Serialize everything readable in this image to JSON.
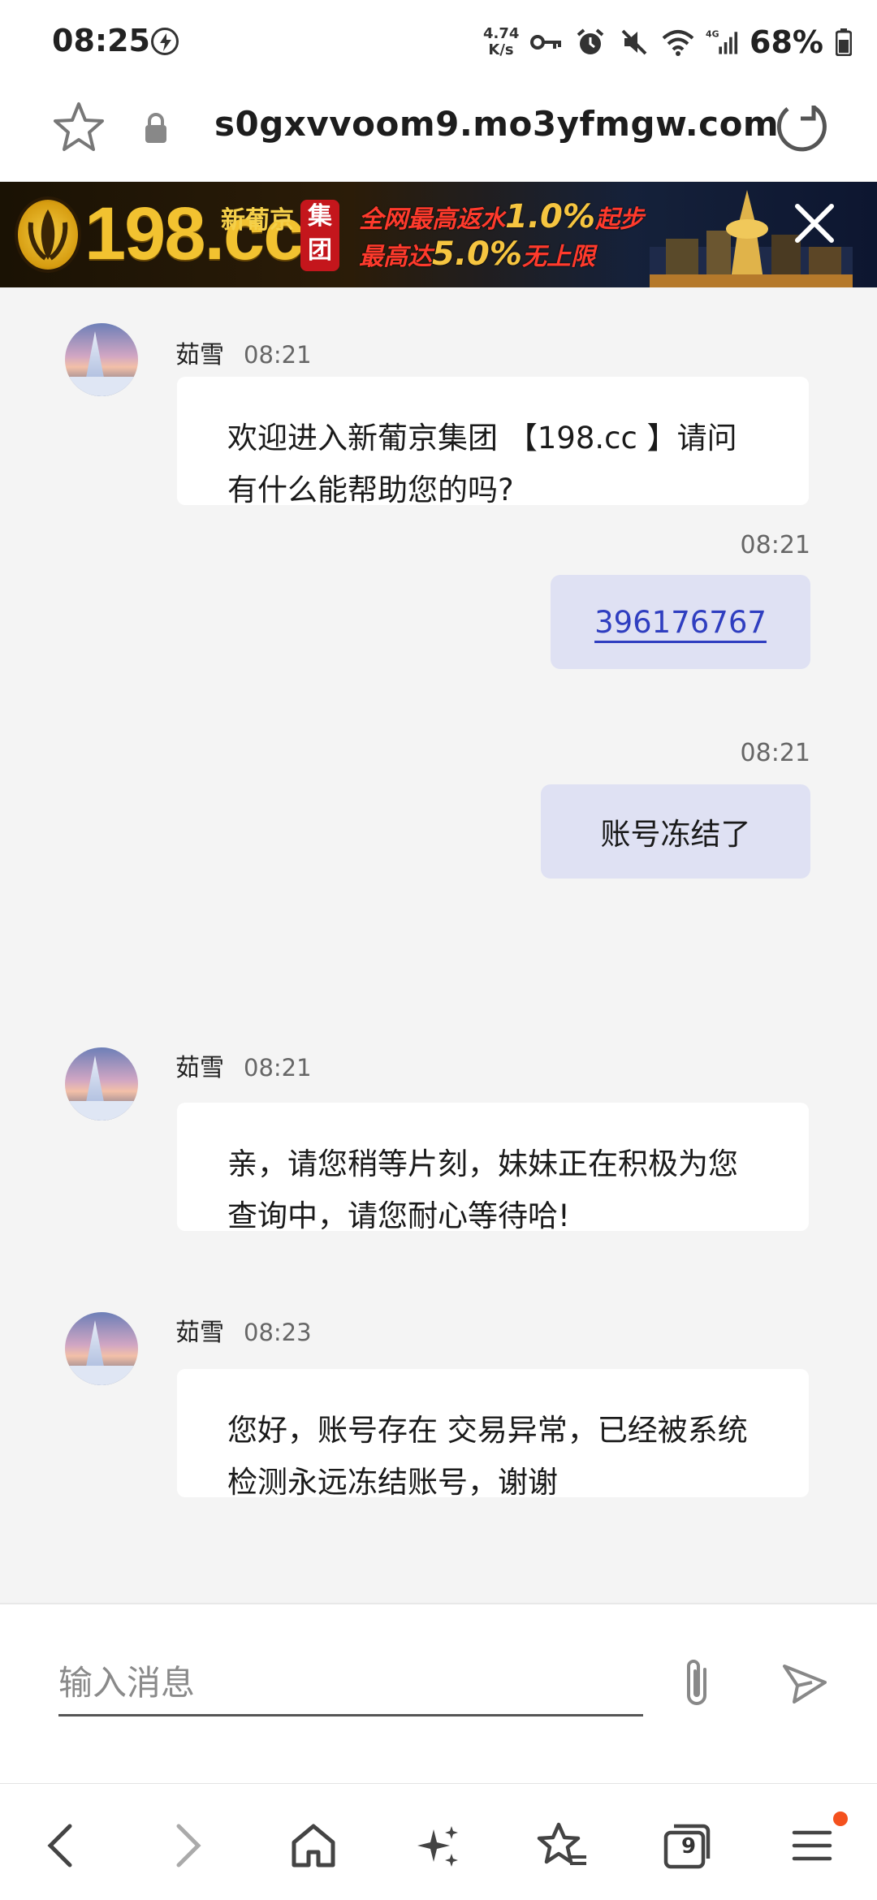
{
  "status_bar": {
    "time": "08:25",
    "net_speed_value": "4.74",
    "net_speed_unit": "K/s",
    "network": "4G",
    "battery": "68%"
  },
  "url_bar": {
    "url": "s0gxvvoom9.mo3yfmgw.com"
  },
  "ad": {
    "brand": "198.cc",
    "sub_brand": "新葡京",
    "seal": "集团",
    "line1_prefix": "全网最高返水",
    "line1_highlight": "1.0%",
    "line1_suffix": "起步",
    "line2_prefix": "最高达",
    "line2_highlight": "5.0%",
    "line2_suffix": "无上限"
  },
  "messages": [
    {
      "sender": "茹雪",
      "time": "08:21",
      "text": "欢迎进入新葡京集团 【198.cc 】请问有什么能帮助您的吗?"
    },
    {
      "time": "08:21",
      "text": "396176767"
    },
    {
      "time": "08:21",
      "text": "账号冻结了"
    },
    {
      "sender": "茹雪",
      "time": "08:21",
      "text": "亲，请您稍等片刻，妹妹正在积极为您查询中，请您耐心等待哈!"
    },
    {
      "sender": "茹雪",
      "time": "08:23",
      "text": "您好，账号存在 交易异常，已经被系统检测永远冻结账号，谢谢"
    }
  ],
  "composer": {
    "placeholder": "输入消息"
  },
  "bottom_nav": {
    "tab_count": "9"
  },
  "colors": {
    "accent_link": "#2f3ec0",
    "outgoing_bubble": "#dfe1f3",
    "notification_dot": "#f4511e"
  }
}
